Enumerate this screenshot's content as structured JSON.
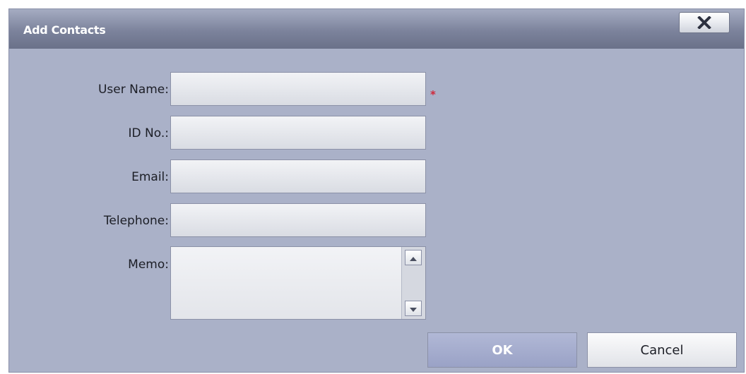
{
  "dialog": {
    "title": "Add Contacts",
    "close_icon": "close-icon"
  },
  "form": {
    "user_name": {
      "label": "User Name:",
      "value": "",
      "required_mark": "*"
    },
    "id_no": {
      "label": "ID No.:",
      "value": ""
    },
    "email": {
      "label": "Email:",
      "value": ""
    },
    "telephone": {
      "label": "Telephone:",
      "value": ""
    },
    "memo": {
      "label": "Memo:",
      "value": ""
    }
  },
  "scrollbar": {
    "up_icon": "scroll-up-arrow-icon",
    "down_icon": "scroll-down-arrow-icon"
  },
  "buttons": {
    "ok": "OK",
    "cancel": "Cancel"
  },
  "colors": {
    "required": "#d0283a",
    "dialog_bg": "#aab1c8",
    "ok_button": "#a4abcd"
  }
}
